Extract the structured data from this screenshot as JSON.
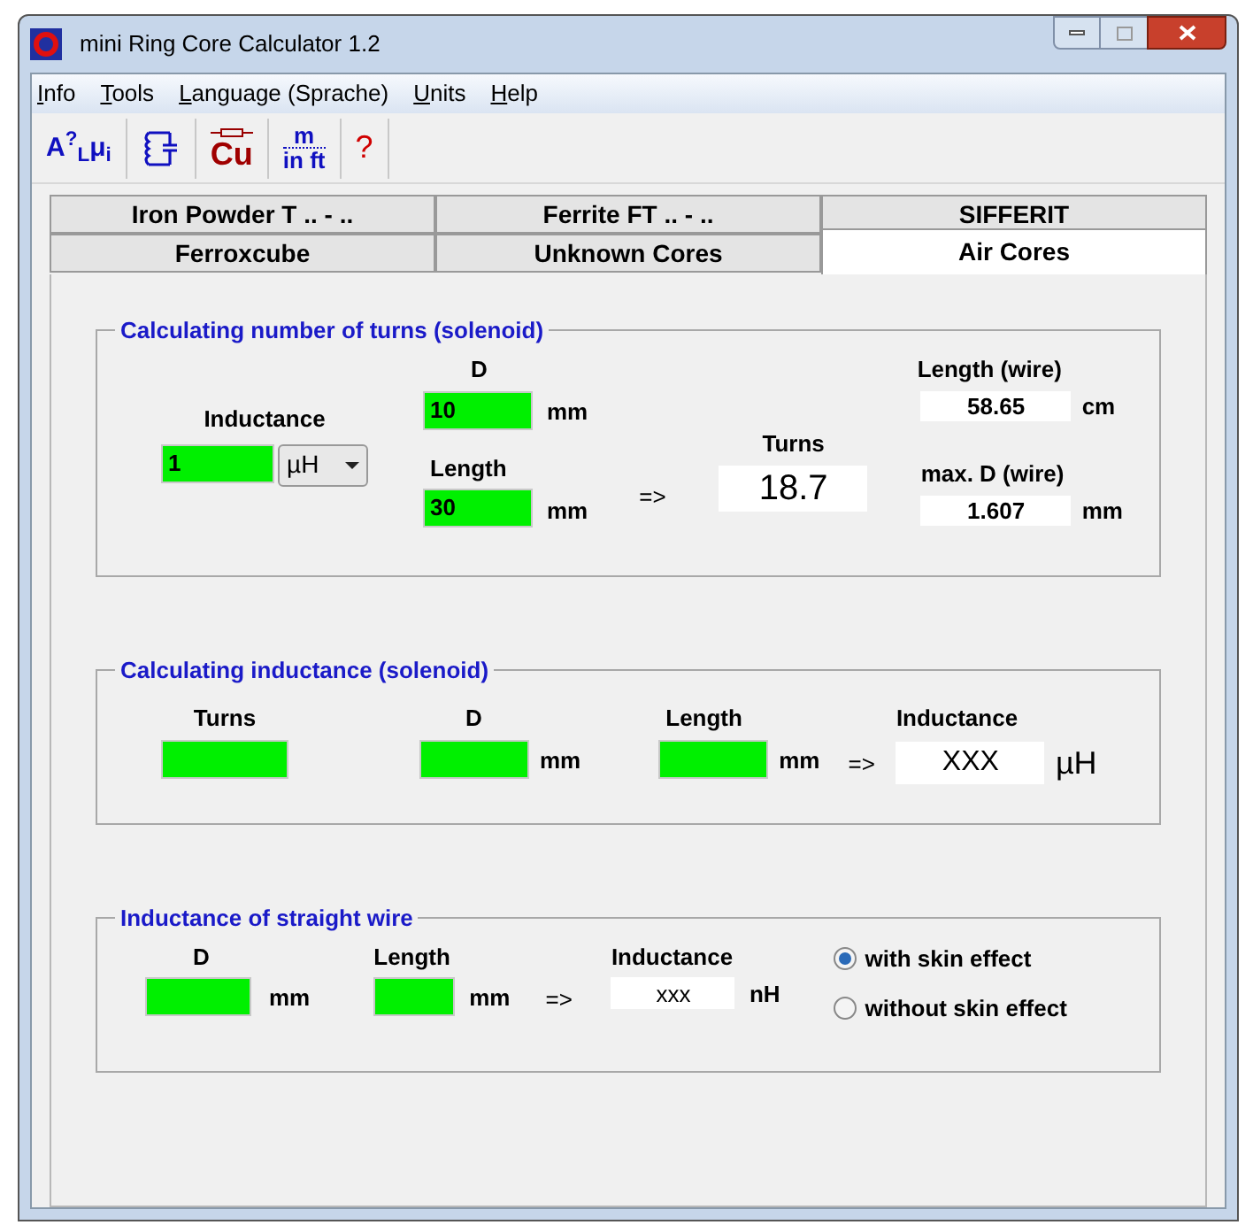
{
  "window": {
    "title": "mini Ring Core Calculator 1.2"
  },
  "menu": [
    {
      "label": "Info"
    },
    {
      "label": "Tools"
    },
    {
      "label": "Language (Sprache)"
    },
    {
      "label": "Units"
    },
    {
      "label": "Help"
    }
  ],
  "toolbar": [
    {
      "kind": "al",
      "label": "A$^{?}$$_{L}$μ$_{i}$"
    },
    {
      "kind": "circuit"
    },
    {
      "kind": "cu",
      "label": "Cu"
    },
    {
      "kind": "units",
      "top": "m",
      "bottom": "in ft"
    },
    {
      "kind": "help",
      "label": "?"
    }
  ],
  "tab_rows": [
    [
      {
        "label": "Iron Powder T .. - ..",
        "selected": false
      },
      {
        "label": "Ferrite FT .. - ..",
        "selected": false
      },
      {
        "label": "SIFFERIT",
        "selected": false
      }
    ],
    [
      {
        "label": "Ferroxcube",
        "selected": false
      },
      {
        "label": "Unknown Cores",
        "selected": false
      },
      {
        "label": "Air Cores",
        "selected": true
      }
    ]
  ],
  "turns_group": {
    "title": "Calculating number of turns (solenoid)",
    "inductance": {
      "label": "Inductance",
      "value": "1",
      "unit": "µH"
    },
    "d": {
      "label": "D",
      "value": "10",
      "unit": "mm"
    },
    "length": {
      "label": "Length",
      "value": "30",
      "unit": "mm"
    },
    "arrow": "=>",
    "turns": {
      "label": "Turns",
      "value": "18.7"
    },
    "wire_length": {
      "label": "Length (wire)",
      "value": "58.65",
      "unit": "cm"
    },
    "wire_d": {
      "label": "max. D (wire)",
      "value": "1.607",
      "unit": "mm"
    }
  },
  "inductance_group": {
    "title": "Calculating inductance (solenoid)",
    "turns": {
      "label": "Turns"
    },
    "d": {
      "label": "D",
      "unit": "mm"
    },
    "length": {
      "label": "Length",
      "unit": "mm"
    },
    "arrow": "=>",
    "inductance": {
      "label": "Inductance",
      "value": "XXX",
      "unit": "µH"
    }
  },
  "wire_group": {
    "title": "Inductance of straight wire",
    "d": {
      "label": "D",
      "unit": "mm"
    },
    "length": {
      "label": "Length",
      "unit": "mm"
    },
    "arrow": "=>",
    "inductance": {
      "label": "Inductance",
      "value": "xxx",
      "unit": "nH"
    },
    "options": [
      {
        "label": "with skin effect",
        "selected": true
      },
      {
        "label": "without skin effect",
        "selected": false
      }
    ]
  }
}
